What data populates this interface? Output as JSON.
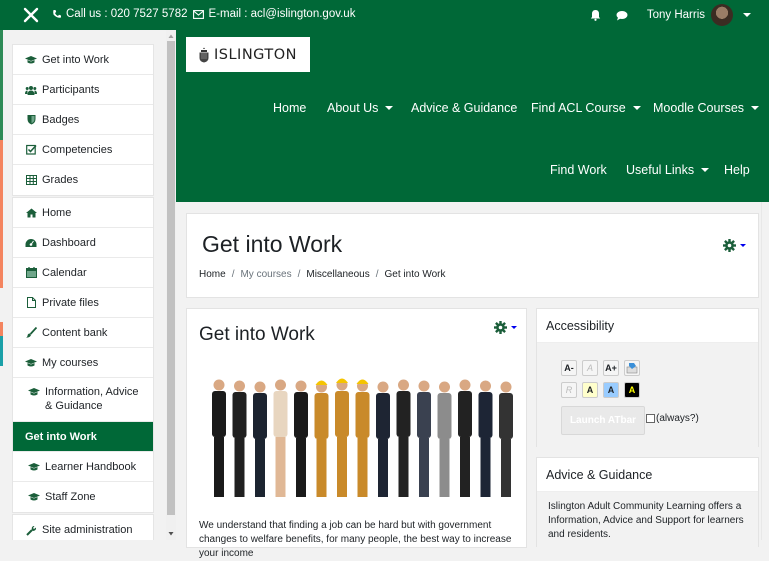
{
  "topbar": {
    "phone_label": "Call us : 020 7527 5782",
    "email_label": "E-mail : acl@islington.gov.uk",
    "user_name": "Tony Harris"
  },
  "drawer": {
    "course_nav": [
      {
        "label": "Get into Work",
        "icon": "graduation-cap-icon"
      },
      {
        "label": "Participants",
        "icon": "users-icon"
      },
      {
        "label": "Badges",
        "icon": "shield-icon"
      },
      {
        "label": "Competencies",
        "icon": "check-square-icon"
      },
      {
        "label": "Grades",
        "icon": "table-icon"
      }
    ],
    "site_nav": [
      {
        "label": "Home",
        "icon": "home-icon"
      },
      {
        "label": "Dashboard",
        "icon": "dashboard-icon"
      },
      {
        "label": "Calendar",
        "icon": "calendar-icon"
      },
      {
        "label": "Private files",
        "icon": "file-icon"
      },
      {
        "label": "Content bank",
        "icon": "paintbrush-icon"
      },
      {
        "label": "My courses",
        "icon": "graduation-cap-icon"
      },
      {
        "label": "Information, Advice & Guidance",
        "icon": "graduation-cap-icon"
      },
      {
        "label": "Get into Work",
        "icon": "",
        "active": true
      },
      {
        "label": "Learner Handbook",
        "icon": "graduation-cap-icon"
      },
      {
        "label": "Staff Zone",
        "icon": "graduation-cap-icon"
      }
    ],
    "admin_nav": [
      {
        "label": "Site administration",
        "icon": "wrench-icon"
      }
    ]
  },
  "header": {
    "logo_text": "ISLINGTON",
    "nav": [
      {
        "label": "Home",
        "dropdown": false
      },
      {
        "label": "About Us",
        "dropdown": true
      },
      {
        "label": "Advice & Guidance",
        "dropdown": false
      },
      {
        "label": "Find ACL Course",
        "dropdown": true
      },
      {
        "label": "Moodle Courses",
        "dropdown": true
      },
      {
        "label": "Find Work",
        "dropdown": false
      },
      {
        "label": "Useful Links",
        "dropdown": true
      },
      {
        "label": "Help",
        "dropdown": false
      }
    ]
  },
  "page": {
    "title": "Get into Work",
    "breadcrumb": [
      "Home",
      "My courses",
      "Miscellaneous",
      "Get into Work"
    ]
  },
  "course": {
    "title": "Get into Work",
    "image_alt": "Group of workers in business suits and construction uniforms",
    "body": "We understand that finding a job can be hard but with government changes to welfare benefits, for many people, the best way to increase your income"
  },
  "blocks": {
    "accessibility": {
      "title": "Accessibility",
      "buttons_row1": [
        "A-",
        "A",
        "A+"
      ],
      "buttons_row2": [
        "R",
        "A",
        "A",
        "A"
      ],
      "launch_label": "Launch ATbar",
      "always_label": "(always?)"
    },
    "advice": {
      "title": "Advice & Guidance",
      "text": "Islington Adult Community Learning offers a Information, Advice and Support for learners and residents."
    }
  }
}
